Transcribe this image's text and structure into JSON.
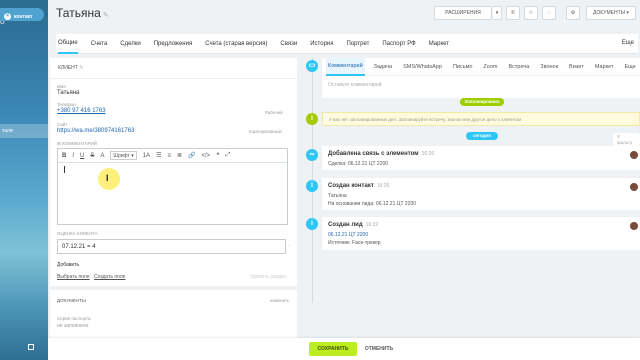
{
  "sidebar": {
    "mark": "G",
    "highlight_label": "тали"
  },
  "header": {
    "contact_tab": "контакт",
    "title": "Татьяна",
    "expansions_button": "РАСШИРЕНИЯ",
    "documents_button": "ДОКУМЕНТЫ"
  },
  "tabs": [
    "Общие",
    "Счета",
    "Сделки",
    "Предложения",
    "Счета (старая версия)",
    "Связи",
    "История",
    "Портрет",
    "Паспорт РФ",
    "Маркет"
  ],
  "tabs_more": "Еще",
  "client": {
    "header": "КЛИЕНТ",
    "name_label": "Имя",
    "name_value": "Татьяна",
    "phone_label": "Телефон",
    "phone_value": "+380 97 416 1763",
    "phone_type": "Рабочий",
    "site_label": "Сайт",
    "site_value": "https://wa.me/380974161763",
    "site_type": "Корпоративный",
    "comment_label": "КОММЕНТАРИЙ",
    "editor_font": "Шрифт",
    "rating_label": "ОЦЕНКА КЛИЕНТА",
    "rating_value": "07.12.21 = 4",
    "add_link": "Добавить",
    "choose_field": "Выбрать поле",
    "create_field": "Создать поле",
    "delete_section": "Удалить раздел"
  },
  "documents": {
    "header": "ДОКУМЕНТЫ",
    "edit_link": "изменить",
    "series_label": "Серия паспорта",
    "series_value": "не заполнено"
  },
  "comments": {
    "tabs": [
      "Комментарий",
      "Задача",
      "SMS/WhatsApp",
      "Письмо",
      "Zoom",
      "Встреча",
      "Звонок",
      "Визит",
      "Маркет"
    ],
    "more": "Еще",
    "placeholder": "Оставьте комментарий"
  },
  "timeline": {
    "planned_pill": "Запланировано",
    "no_plans_text": "У вас нет запланированных дел. Запланируйте встречу, звонок или другое дело с клиентом",
    "today_pill": "сегодня",
    "filter_label": "фильтр",
    "events": [
      {
        "title": "Добавлена связь с элементом",
        "time": "16:26",
        "body": [
          "Сделка: 06.12.21 ЦТ 2200"
        ]
      },
      {
        "title": "Создан контакт",
        "time": "16:26",
        "body": [
          "Татьяна",
          "На основании лида: 06.12.21 ЦТ 2200"
        ]
      },
      {
        "title": "Создан лид",
        "time": "16:22",
        "body": [
          "06.12.21 ЦТ 2200",
          "Источник: Face-трекер"
        ]
      }
    ]
  },
  "footer": {
    "save": "СОХРАНИТЬ",
    "cancel": "ОТМЕНИТЬ"
  },
  "colors": {
    "accent": "#2fc6f6",
    "save_green": "#bbed21",
    "planned_green": "#9dcf00",
    "info_blue": "#2fc6f6",
    "info_yellow": "#a8c900"
  }
}
